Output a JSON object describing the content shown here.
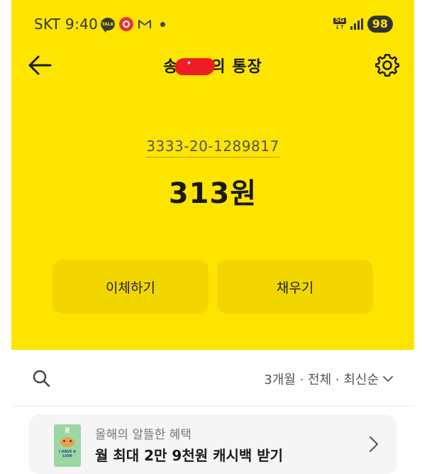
{
  "status_bar": {
    "carrier": "SKT",
    "time": "9:40",
    "talk_icon_text": "TALK",
    "network": "5G",
    "battery": "98"
  },
  "header": {
    "title_prefix": "송",
    "title_suffix": "의 통장"
  },
  "account": {
    "number": "3333-20-1289817",
    "balance": "313원"
  },
  "actions": {
    "transfer_label": "이체하기",
    "fill_label": "채우기"
  },
  "filter": {
    "label": "3개월 · 전체 · 최신순"
  },
  "promo": {
    "subtitle": "올해의 알뜰한 혜택",
    "title": "월 최대 2만 9천원 캐시백 받기",
    "thumb_text": "I HAVE A LION"
  },
  "colors": {
    "accent": "#fee500",
    "button": "#f2d600",
    "redaction": "#ee1c25"
  }
}
